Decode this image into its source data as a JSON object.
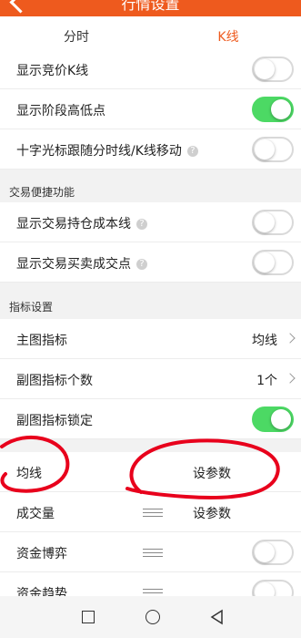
{
  "header": {
    "title": "行情设置"
  },
  "tabs": [
    {
      "label": "分时",
      "active": false
    },
    {
      "label": "K线",
      "active": true
    }
  ],
  "kline_section": {
    "items": [
      {
        "label": "显示竞价K线",
        "help": false,
        "toggle": "off"
      },
      {
        "label": "显示阶段高低点",
        "help": false,
        "toggle": "on"
      },
      {
        "label": "十字光标跟随分时线/K线移动",
        "help": true,
        "toggle": "off"
      }
    ]
  },
  "trade_section": {
    "title": "交易便捷功能",
    "items": [
      {
        "label": "显示交易持仓成本线",
        "help": true,
        "toggle": "off"
      },
      {
        "label": "显示交易买卖成交点",
        "help": true,
        "toggle": "off"
      }
    ]
  },
  "indicator_section": {
    "title": "指标设置",
    "main_indicator": {
      "label": "主图指标",
      "value": "均线"
    },
    "sub_count": {
      "label": "副图指标个数",
      "value": "1个"
    },
    "sub_lock": {
      "label": "副图指标锁定",
      "toggle": "on"
    }
  },
  "indicator_list": [
    {
      "label": "均线",
      "action": "设参数"
    },
    {
      "label": "成交量",
      "action": "设参数"
    },
    {
      "label": "资金博弈",
      "toggle": "off"
    },
    {
      "label": "资金趋势",
      "toggle": "off"
    }
  ],
  "help_icon": "?",
  "icons": {
    "back": "back-arrow-icon",
    "help": "question-icon",
    "chevron": "chevron-right-icon",
    "drag": "drag-handle-icon",
    "nav_recent": "square-icon",
    "nav_home": "circle-icon",
    "nav_back": "triangle-back-icon"
  },
  "colors": {
    "accent": "#ee5a1e",
    "toggle_on": "#4cd964",
    "annotation": "#e8001c"
  }
}
